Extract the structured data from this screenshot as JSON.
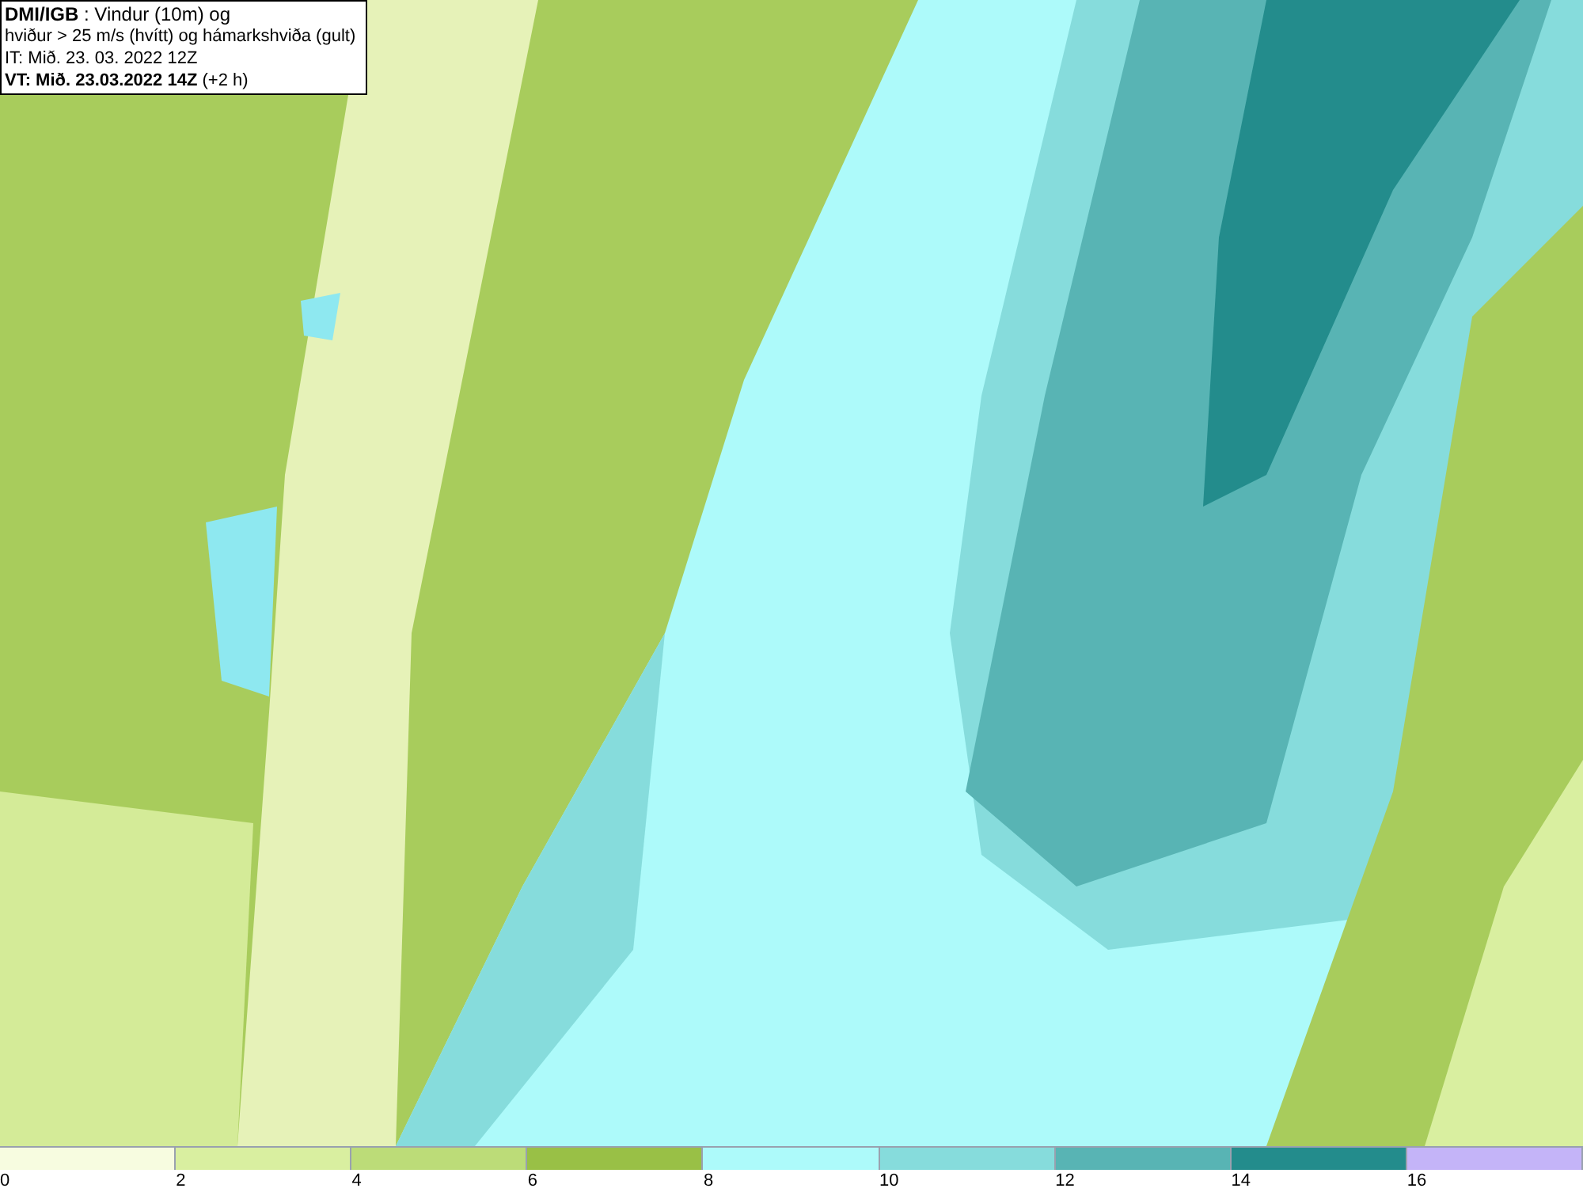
{
  "title_box": {
    "lines": [
      "**DMI/IGB** : Vindur (10m) og",
      "hviður > 25 m/s (hvítt) og hámarkshviða (gult)",
      "IT: Mið. 23. 03. 2022 12Z",
      "**VT: Mið. 23.03.2022 14Z** (+2 h)"
    ]
  },
  "legend": {
    "segments": [
      {
        "color": "#f7fce0",
        "label": "0"
      },
      {
        "color": "#d9efa0",
        "label": "2"
      },
      {
        "color": "#bcdc78",
        "label": "4"
      },
      {
        "color": "#99c046",
        "label": "6"
      },
      {
        "color": "#adfafa",
        "label": "8"
      },
      {
        "color": "#86dcdc",
        "label": "10"
      },
      {
        "color": "#58b4b4",
        "label": "12"
      },
      {
        "color": "#238c8c",
        "label": "14"
      },
      {
        "color": "#c4b4f8",
        "label": "16"
      }
    ]
  }
}
